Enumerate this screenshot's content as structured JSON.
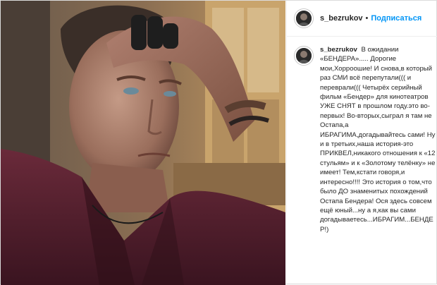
{
  "post": {
    "username": "s_bezrukov",
    "separator": "•",
    "follow_label": "Подписаться",
    "caption_author": "s_bezrukov",
    "caption_text": "В ожидании «БЕНДЕРА»..... Дорогие мои,Хорроошие! И снова,в который раз СМИ всё перепутали((( и переврали((( Четырёх серийный фильм «Бендер» для кинотеатров УЖЕ СНЯТ в прошлом году.это во-первых! Во-вторых,сыграл я там не Остапа,а ИБРАГИМА,догадывайтесь сами! Ну и в третьих,наша история-это ПРИКВЕЛ,никакого отношения к «12 стульям» и к «Золотому телёнку» не имеет! Тем,кстати говоря,и интересно!!!! Это история о том,что было ДО знаменитых похождений Остапа Бендера! Ося здесь совсем ещё юный...ну а я,как вы сами догадываетесь...ИБРАГИМ...БЕНДЕР!)"
  },
  "icons": {
    "photo": "portrait-photo",
    "avatar": "profile-avatar"
  },
  "colors": {
    "link": "#0095f6",
    "text": "#262626",
    "border": "#dbdbdb"
  }
}
